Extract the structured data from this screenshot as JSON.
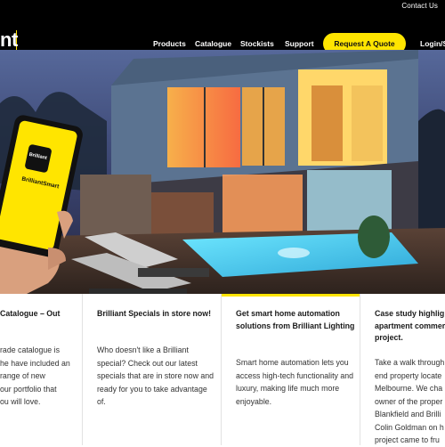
{
  "header": {
    "contact_label": "Contact Us",
    "logo_text": "nt",
    "nav": [
      {
        "label": "Products"
      },
      {
        "label": "Catalogue"
      },
      {
        "label": "Stockists"
      },
      {
        "label": "Support"
      }
    ],
    "quote_button": "Request A Quote",
    "login_label": "Login/S"
  },
  "hero": {
    "phone_brand": "Brilliant",
    "phone_app": "BrilliantSmart",
    "accent_color": "#ffe500"
  },
  "cards": [
    {
      "title": "Catalogue – Out",
      "body": "rade catalogue is\nhe have included an\nrange of new\nour portfolio that\nou will love."
    },
    {
      "title": "Brilliant Specials in store now!",
      "body": "Who doesn't like a Brilliant special? Check out our latest specials that are in store now and ready for you to take advantage of."
    },
    {
      "title": "Get smart home automation solutions from Brilliant Lighting",
      "body": "Smart home automation lets you access high-tech functionality and luxury, making life much more enjoyable."
    },
    {
      "title": "Case study highlig\napartment commer\nproject.",
      "body": "Take a walk through\nend property locate\nMelbourne. We cha\nowner of the proper\nBlankfield and Brilli\nColin Goldman on h\nproject came to fru"
    }
  ]
}
